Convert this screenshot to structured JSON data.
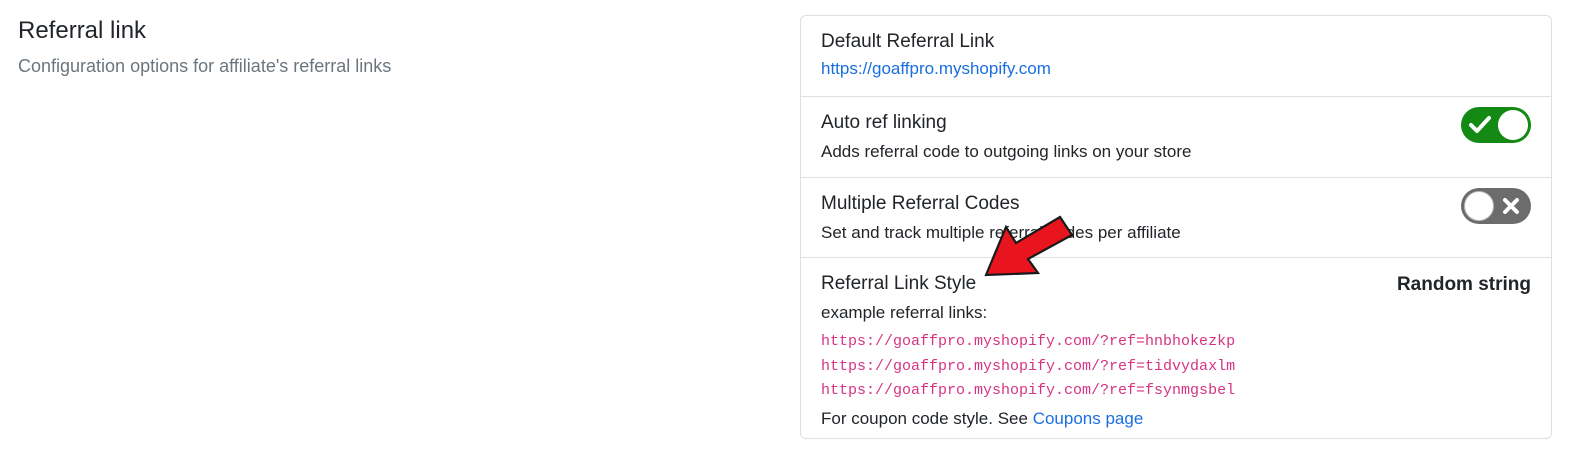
{
  "section": {
    "title": "Referral link",
    "description": "Configuration options for affiliate's referral links"
  },
  "default_link": {
    "title": "Default Referral Link",
    "url": "https://goaffpro.myshopify.com"
  },
  "auto_ref": {
    "title": "Auto ref linking",
    "description": "Adds referral code to outgoing links on your store",
    "enabled": true,
    "icon": "check-icon"
  },
  "multiple_codes": {
    "title": "Multiple Referral Codes",
    "description": "Set and track multiple referral codes per affiliate",
    "enabled": false,
    "icon": "x-icon"
  },
  "link_style": {
    "title": "Referral Link Style",
    "value": "Random string",
    "examples_label": "example referral links:",
    "examples": [
      "https://goaffpro.myshopify.com/?ref=hnbhokezkp",
      "https://goaffpro.myshopify.com/?ref=tidvydaxlm",
      "https://goaffpro.myshopify.com/?ref=fsynmgsbel"
    ],
    "coupon_note": "For coupon code style. See",
    "coupon_link": "Coupons page"
  },
  "colors": {
    "toggle_on": "#148a14",
    "toggle_off": "#6c6c6c",
    "link": "#1a6fe0",
    "code": "#d63384",
    "arrow": "#e8141e"
  }
}
